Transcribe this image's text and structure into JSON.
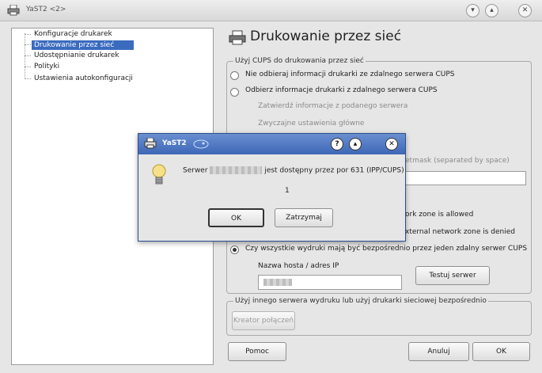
{
  "main_window": {
    "title": "YaST2 <2>",
    "icon": "printer-icon",
    "btn_min": "▾",
    "btn_max": "▴",
    "btn_close": "✕"
  },
  "tree": {
    "items": [
      "Konfiguracje drukarek",
      "Drukowanie przez sieć",
      "Udostępnianie drukarek",
      "Polityki",
      "Ustawienia autokonfiguracji"
    ],
    "selected_index": 1
  },
  "panel": {
    "heading": "Drukowanie przez sieć",
    "cups_group": {
      "label": "Użyj CUPS do drukowania przez sieć",
      "radio1": "Nie odbieraj informacji drukarki ze zdalnego serwera CUPS",
      "radio2": "Odbierz informacje drukarki z zdalnego serwera CUPS",
      "sub1": "Zatwierdź informacje z podanego serwera",
      "sub2": "Zwyczajne ustawienia główne",
      "partial_netmask": "etmask (separated by space)",
      "partial_zone1": "ork zone is allowed",
      "partial_zone2": "xternal network zone is denied",
      "radio3": "Czy wszystkie wydruki mają być bezpośrednio przez jeden zdalny serwer CUPS",
      "host_label": "Nazwa hosta / adres IP",
      "test_button": "Testuj serwer"
    },
    "other_group": {
      "label": "Użyj innego serwera wydruku lub użyj drukarki sieciowej bezpośrednio",
      "wizard_button": "Kreator połączeń"
    }
  },
  "bottom": {
    "help": "Pomoc",
    "cancel": "Anuluj",
    "ok": "OK"
  },
  "dialog": {
    "title": "YaST2",
    "icon": "printer-icon",
    "help_btn": "?",
    "max_btn": "▴",
    "close_btn": "✕",
    "message_prefix": "Serwer",
    "message_suffix": "jest dostępny przez por 631 (IPP/CUPS)",
    "count": "1",
    "ok": "OK",
    "stop": "Zatrzymaj"
  },
  "colors": {
    "selection": "#3a6bbf",
    "dialog_title": "#3d67b7"
  }
}
